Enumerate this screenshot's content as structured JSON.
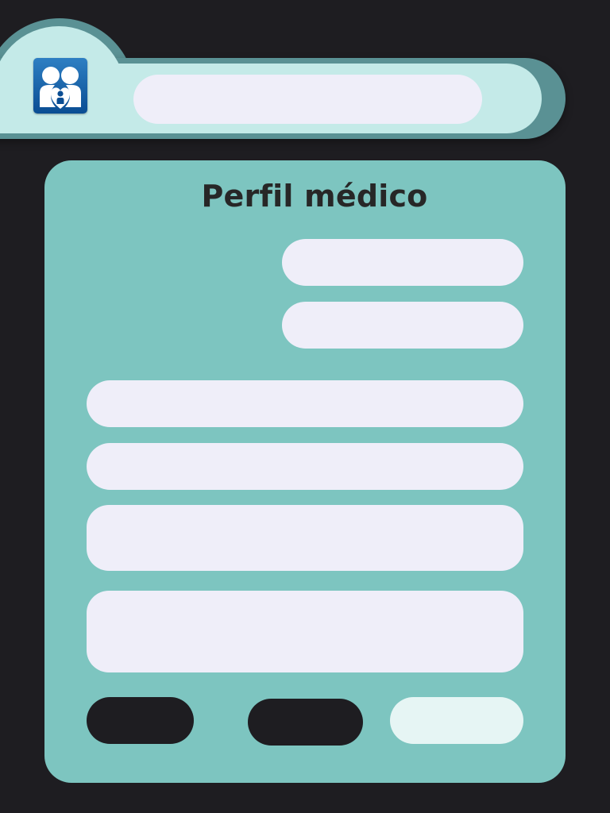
{
  "header": {
    "logo_icon": "family-heart-icon",
    "search": {
      "value": "",
      "placeholder": ""
    }
  },
  "profile_form": {
    "title": "Perfil médico",
    "fields": [
      {
        "value": "",
        "placeholder": ""
      },
      {
        "value": "",
        "placeholder": ""
      },
      {
        "value": "",
        "placeholder": ""
      },
      {
        "value": "",
        "placeholder": ""
      },
      {
        "value": "",
        "placeholder": ""
      },
      {
        "value": "",
        "placeholder": ""
      }
    ],
    "buttons": [
      {
        "label": ""
      },
      {
        "label": ""
      },
      {
        "label": ""
      }
    ]
  },
  "colors": {
    "background": "#1e1d21",
    "header": "#c4eae8",
    "header_shadow": "#5a9194",
    "card": "#7dc5c0",
    "field": "#efeef9",
    "dark_button": "#1e1d21",
    "light_button": "#e6f5f4",
    "logo_blue": "#0a4d93"
  }
}
